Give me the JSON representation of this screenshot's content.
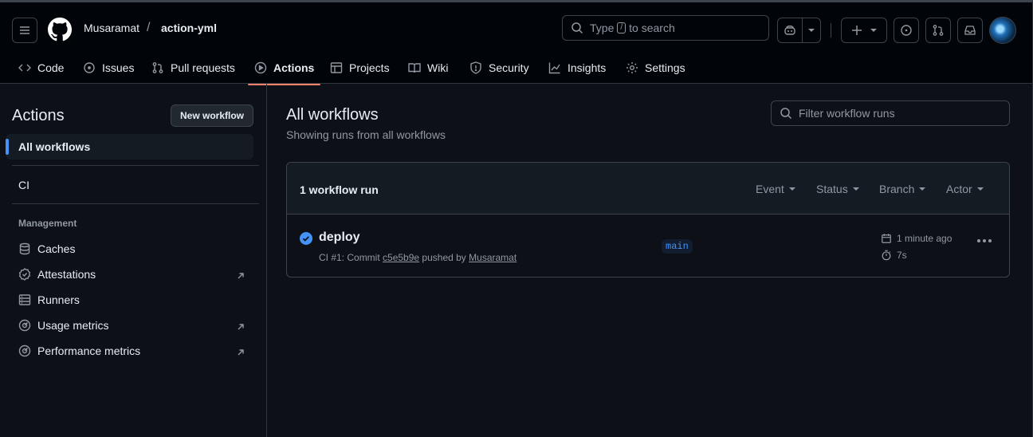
{
  "header": {
    "owner": "Musaramat",
    "separator": "/",
    "repo": "action-yml",
    "search_prefix": "Type",
    "search_key": "/",
    "search_suffix": "to search"
  },
  "tabs": [
    {
      "label": "Code",
      "icon": "code-icon"
    },
    {
      "label": "Issues",
      "icon": "issue-icon"
    },
    {
      "label": "Pull requests",
      "icon": "pull-request-icon"
    },
    {
      "label": "Actions",
      "icon": "play-icon",
      "active": true
    },
    {
      "label": "Projects",
      "icon": "table-icon"
    },
    {
      "label": "Wiki",
      "icon": "book-icon"
    },
    {
      "label": "Security",
      "icon": "shield-icon"
    },
    {
      "label": "Insights",
      "icon": "graph-icon"
    },
    {
      "label": "Settings",
      "icon": "gear-icon"
    }
  ],
  "sidebar": {
    "title": "Actions",
    "new_workflow": "New workflow",
    "selected": "All workflows",
    "workflows": [
      "CI"
    ],
    "management_heading": "Management",
    "management": [
      {
        "label": "Caches",
        "icon": "database-icon",
        "external": false
      },
      {
        "label": "Attestations",
        "icon": "verified-icon",
        "external": true
      },
      {
        "label": "Runners",
        "icon": "server-icon",
        "external": false
      },
      {
        "label": "Usage metrics",
        "icon": "meter-icon",
        "external": true
      },
      {
        "label": "Performance metrics",
        "icon": "meter-icon",
        "external": true
      }
    ]
  },
  "main": {
    "title": "All workflows",
    "subtitle": "Showing runs from all workflows",
    "filter_placeholder": "Filter workflow runs",
    "run_count": "1 workflow run",
    "filters": [
      "Event",
      "Status",
      "Branch",
      "Actor"
    ],
    "runs": [
      {
        "name": "deploy",
        "meta_prefix": "CI #1: Commit",
        "commit": "c5e5b9e",
        "meta_mid": "pushed by",
        "actor": "Musaramat",
        "branch": "main",
        "time": "1 minute ago",
        "duration": "7s",
        "status": "success",
        "status_color": "#4493f8"
      }
    ]
  },
  "colors": {
    "accent": "#f78166",
    "link": "#4493f8",
    "bg": "#0d1117",
    "header_bg": "#010409"
  }
}
